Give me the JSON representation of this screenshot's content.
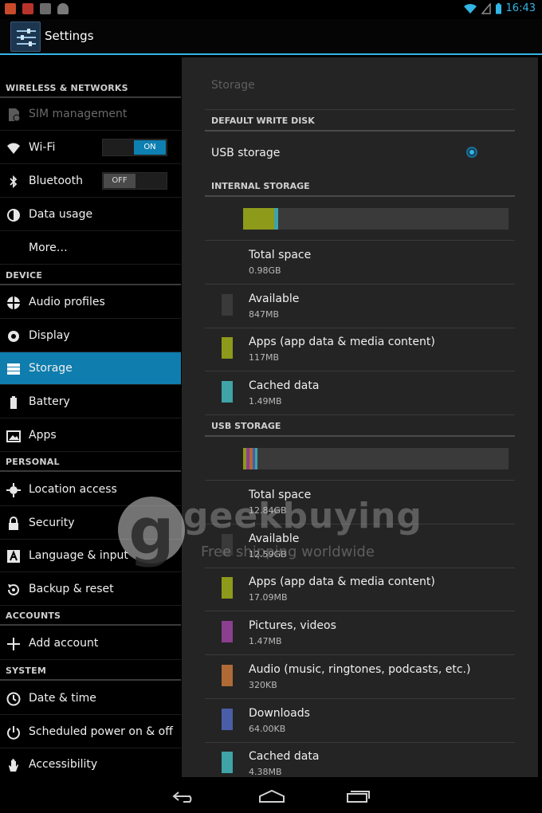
{
  "status_bar": {
    "time": "16:43"
  },
  "action_bar": {
    "title": "Settings"
  },
  "nav": {
    "sections": [
      {
        "header": "WIRELESS & NETWORKS",
        "items": [
          {
            "label": "SIM management",
            "icon": "sim-card-icon",
            "disabled": true
          },
          {
            "label": "Wi-Fi",
            "icon": "wifi-icon",
            "toggle": "ON"
          },
          {
            "label": "Bluetooth",
            "icon": "bluetooth-icon",
            "toggle": "OFF"
          },
          {
            "label": "Data usage",
            "icon": "data-usage-icon"
          },
          {
            "label": "More…",
            "icon": ""
          }
        ]
      },
      {
        "header": "DEVICE",
        "items": [
          {
            "label": "Audio profiles",
            "icon": "audio-profiles-icon"
          },
          {
            "label": "Display",
            "icon": "display-icon"
          },
          {
            "label": "Storage",
            "icon": "storage-icon",
            "active": true
          },
          {
            "label": "Battery",
            "icon": "battery-icon"
          },
          {
            "label": "Apps",
            "icon": "apps-icon"
          }
        ]
      },
      {
        "header": "PERSONAL",
        "items": [
          {
            "label": "Location access",
            "icon": "location-icon"
          },
          {
            "label": "Security",
            "icon": "lock-icon"
          },
          {
            "label": "Language & input",
            "icon": "language-icon"
          },
          {
            "label": "Backup & reset",
            "icon": "backup-icon"
          }
        ]
      },
      {
        "header": "ACCOUNTS",
        "items": [
          {
            "label": "Add account",
            "icon": "plus-icon"
          }
        ]
      },
      {
        "header": "SYSTEM",
        "items": [
          {
            "label": "Date & time",
            "icon": "clock-icon"
          },
          {
            "label": "Scheduled power on & off",
            "icon": "scheduled-power-icon"
          },
          {
            "label": "Accessibility",
            "icon": "hand-icon"
          }
        ]
      }
    ]
  },
  "panel": {
    "title": "Storage",
    "default_write": {
      "header": "DEFAULT WRITE DISK",
      "option": "USB storage",
      "selected": true
    },
    "internal": {
      "header": "INTERNAL STORAGE",
      "usage_bar": [
        {
          "name": "Apps",
          "fraction": 0.117,
          "color": "#8e9a1a"
        },
        {
          "name": "Cached data",
          "fraction": 0.015,
          "color": "#3fa3a8"
        }
      ],
      "rows": [
        {
          "title": "Total space",
          "value": "0.98GB",
          "color": ""
        },
        {
          "title": "Available",
          "value": "847MB",
          "color": "#3a3a3a"
        },
        {
          "title": "Apps (app data & media content)",
          "value": "117MB",
          "color": "#8e9a1a"
        },
        {
          "title": "Cached data",
          "value": "1.49MB",
          "color": "#3fa3a8"
        }
      ]
    },
    "usb": {
      "header": "USB STORAGE",
      "usage_bar": [
        {
          "name": "Apps",
          "fraction": 0.013,
          "color": "#8e9a1a"
        },
        {
          "name": "Pictures, videos",
          "fraction": 0.012,
          "color": "#8b3f8f"
        },
        {
          "name": "Audio",
          "fraction": 0.01,
          "color": "#b06a36"
        },
        {
          "name": "Downloads",
          "fraction": 0.01,
          "color": "#4a5ea8"
        },
        {
          "name": "Cached data",
          "fraction": 0.01,
          "color": "#3fa3a8"
        }
      ],
      "rows": [
        {
          "title": "Total space",
          "value": "12.84GB",
          "color": ""
        },
        {
          "title": "Available",
          "value": "12.59GB",
          "color": "#3a3a3a"
        },
        {
          "title": "Apps (app data & media content)",
          "value": "17.09MB",
          "color": "#8e9a1a"
        },
        {
          "title": "Pictures, videos",
          "value": "1.47MB",
          "color": "#8b3f8f"
        },
        {
          "title": "Audio (music, ringtones, podcasts, etc.)",
          "value": "320KB",
          "color": "#b06a36"
        },
        {
          "title": "Downloads",
          "value": "64.00KB",
          "color": "#4a5ea8"
        },
        {
          "title": "Cached data",
          "value": "4.38MB",
          "color": "#3fa3a8"
        }
      ]
    }
  },
  "watermark": {
    "brand": "geekbuying",
    "tagline": "Free shipping worldwide"
  },
  "colors": {
    "accent": "#33b5e5",
    "active_item": "#0f7dae",
    "panel_bg": "#242424"
  }
}
